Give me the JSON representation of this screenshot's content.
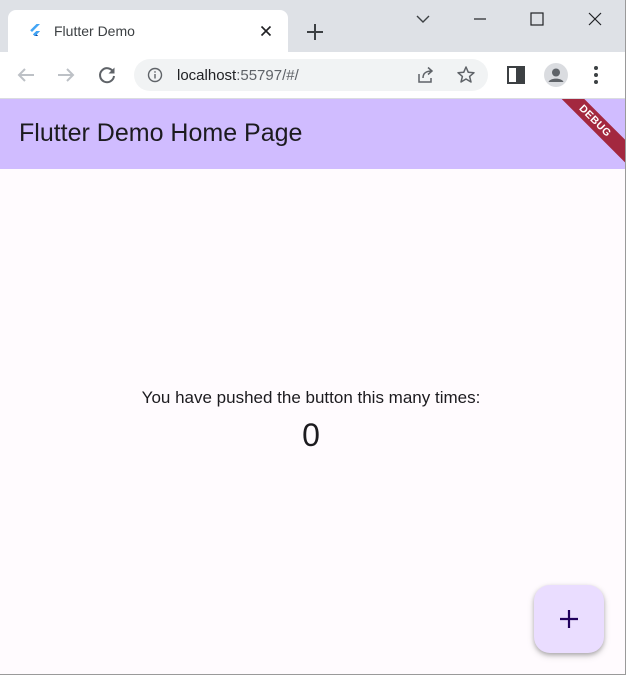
{
  "browser": {
    "tab": {
      "title": "Flutter Demo",
      "favicon": "flutter-logo-icon",
      "close_icon": "close-icon"
    },
    "new_tab_icon": "plus-icon",
    "window_controls": [
      "tab-search-icon",
      "minimize-icon",
      "maximize-icon",
      "close-window-icon"
    ],
    "toolbar": {
      "back_icon": "back-arrow-icon",
      "forward_icon": "forward-arrow-icon",
      "reload_icon": "reload-icon",
      "site_info_icon": "info-icon",
      "url_host": "localhost",
      "url_rest": ":55797/#/",
      "share_icon": "share-icon",
      "bookmark_icon": "star-icon",
      "side_panel_icon": "side-panel-icon",
      "profile_icon": "profile-icon",
      "menu_icon": "more-vert-icon"
    }
  },
  "app": {
    "appbar_title": "Flutter Demo Home Page",
    "debug_banner": "DEBUG",
    "counter_label": "You have pushed the button this many times:",
    "counter_value": "0",
    "fab_icon": "add-icon",
    "colors": {
      "appbar": "#d0bcff",
      "background": "#fffbfe",
      "fab": "#eaddff",
      "banner": "#a3283f"
    }
  }
}
